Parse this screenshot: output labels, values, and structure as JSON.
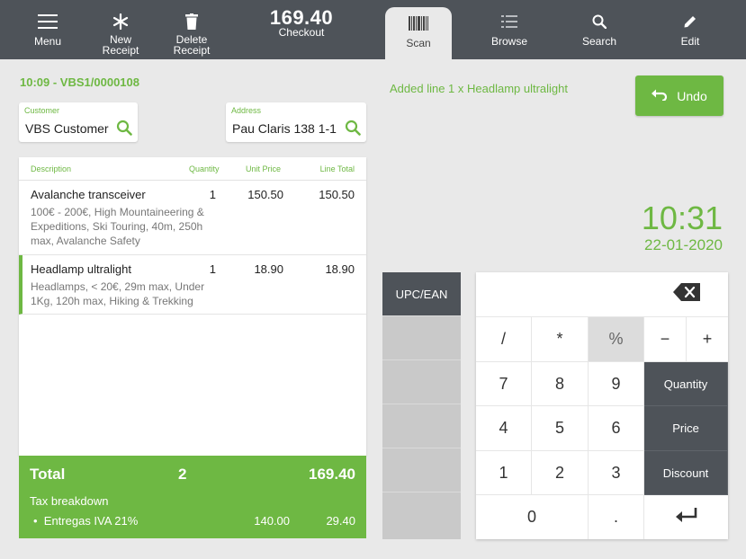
{
  "toolbar": {
    "menu": "Menu",
    "new_receipt": [
      "New",
      "Receipt"
    ],
    "delete_receipt": [
      "Delete",
      "Receipt"
    ],
    "checkout_total": "169.40",
    "checkout": "Checkout",
    "scan": "Scan",
    "browse": "Browse",
    "search": "Search",
    "edit": "Edit"
  },
  "receipt": {
    "id": "10:09 - VBS1/0000108",
    "customer_label": "Customer",
    "customer": "VBS Customer",
    "address_label": "Address",
    "address": "Pau Claris 138 1-1"
  },
  "lines_header": {
    "description": "Description",
    "quantity": "Quantity",
    "unit_price": "Unit Price",
    "line_total": "Line Total"
  },
  "lines": [
    {
      "description": "Avalanche transceiver",
      "quantity": "1",
      "unit_price": "150.50",
      "line_total": "150.50",
      "attributes": "100€ - 200€, High Mountaineering & Expeditions, Ski Touring, 40m, 250h max, Avalanche Safety"
    },
    {
      "description": "Headlamp ultralight",
      "quantity": "1",
      "unit_price": "18.90",
      "line_total": "18.90",
      "attributes": "Headlamps, < 20€, 29m max, Under 1Kg, 120h max, Hiking & Trekking"
    }
  ],
  "totals": {
    "label": "Total",
    "count": "2",
    "amount": "169.40",
    "tax_header": "Tax breakdown",
    "tax_line": "Entregas IVA 21%",
    "tax_base": "140.00",
    "tax_amount": "29.40"
  },
  "message": "Added line 1 x Headlamp ultralight",
  "undo": "Undo",
  "clock": {
    "time": "10:31",
    "date": "22-01-2020"
  },
  "side": {
    "upc": "UPC/EAN"
  },
  "keypad": {
    "slash": "/",
    "star": "*",
    "percent": "%",
    "minus": "−",
    "plus": "+",
    "k7": "7",
    "k8": "8",
    "k9": "9",
    "k4": "4",
    "k5": "5",
    "k6": "6",
    "k1": "1",
    "k2": "2",
    "k3": "3",
    "k0": "0",
    "dot": ".",
    "quantity": "Quantity",
    "price": "Price",
    "discount": "Discount"
  },
  "colors": {
    "accent": "#6eb843",
    "toolbar": "#4e5359"
  }
}
